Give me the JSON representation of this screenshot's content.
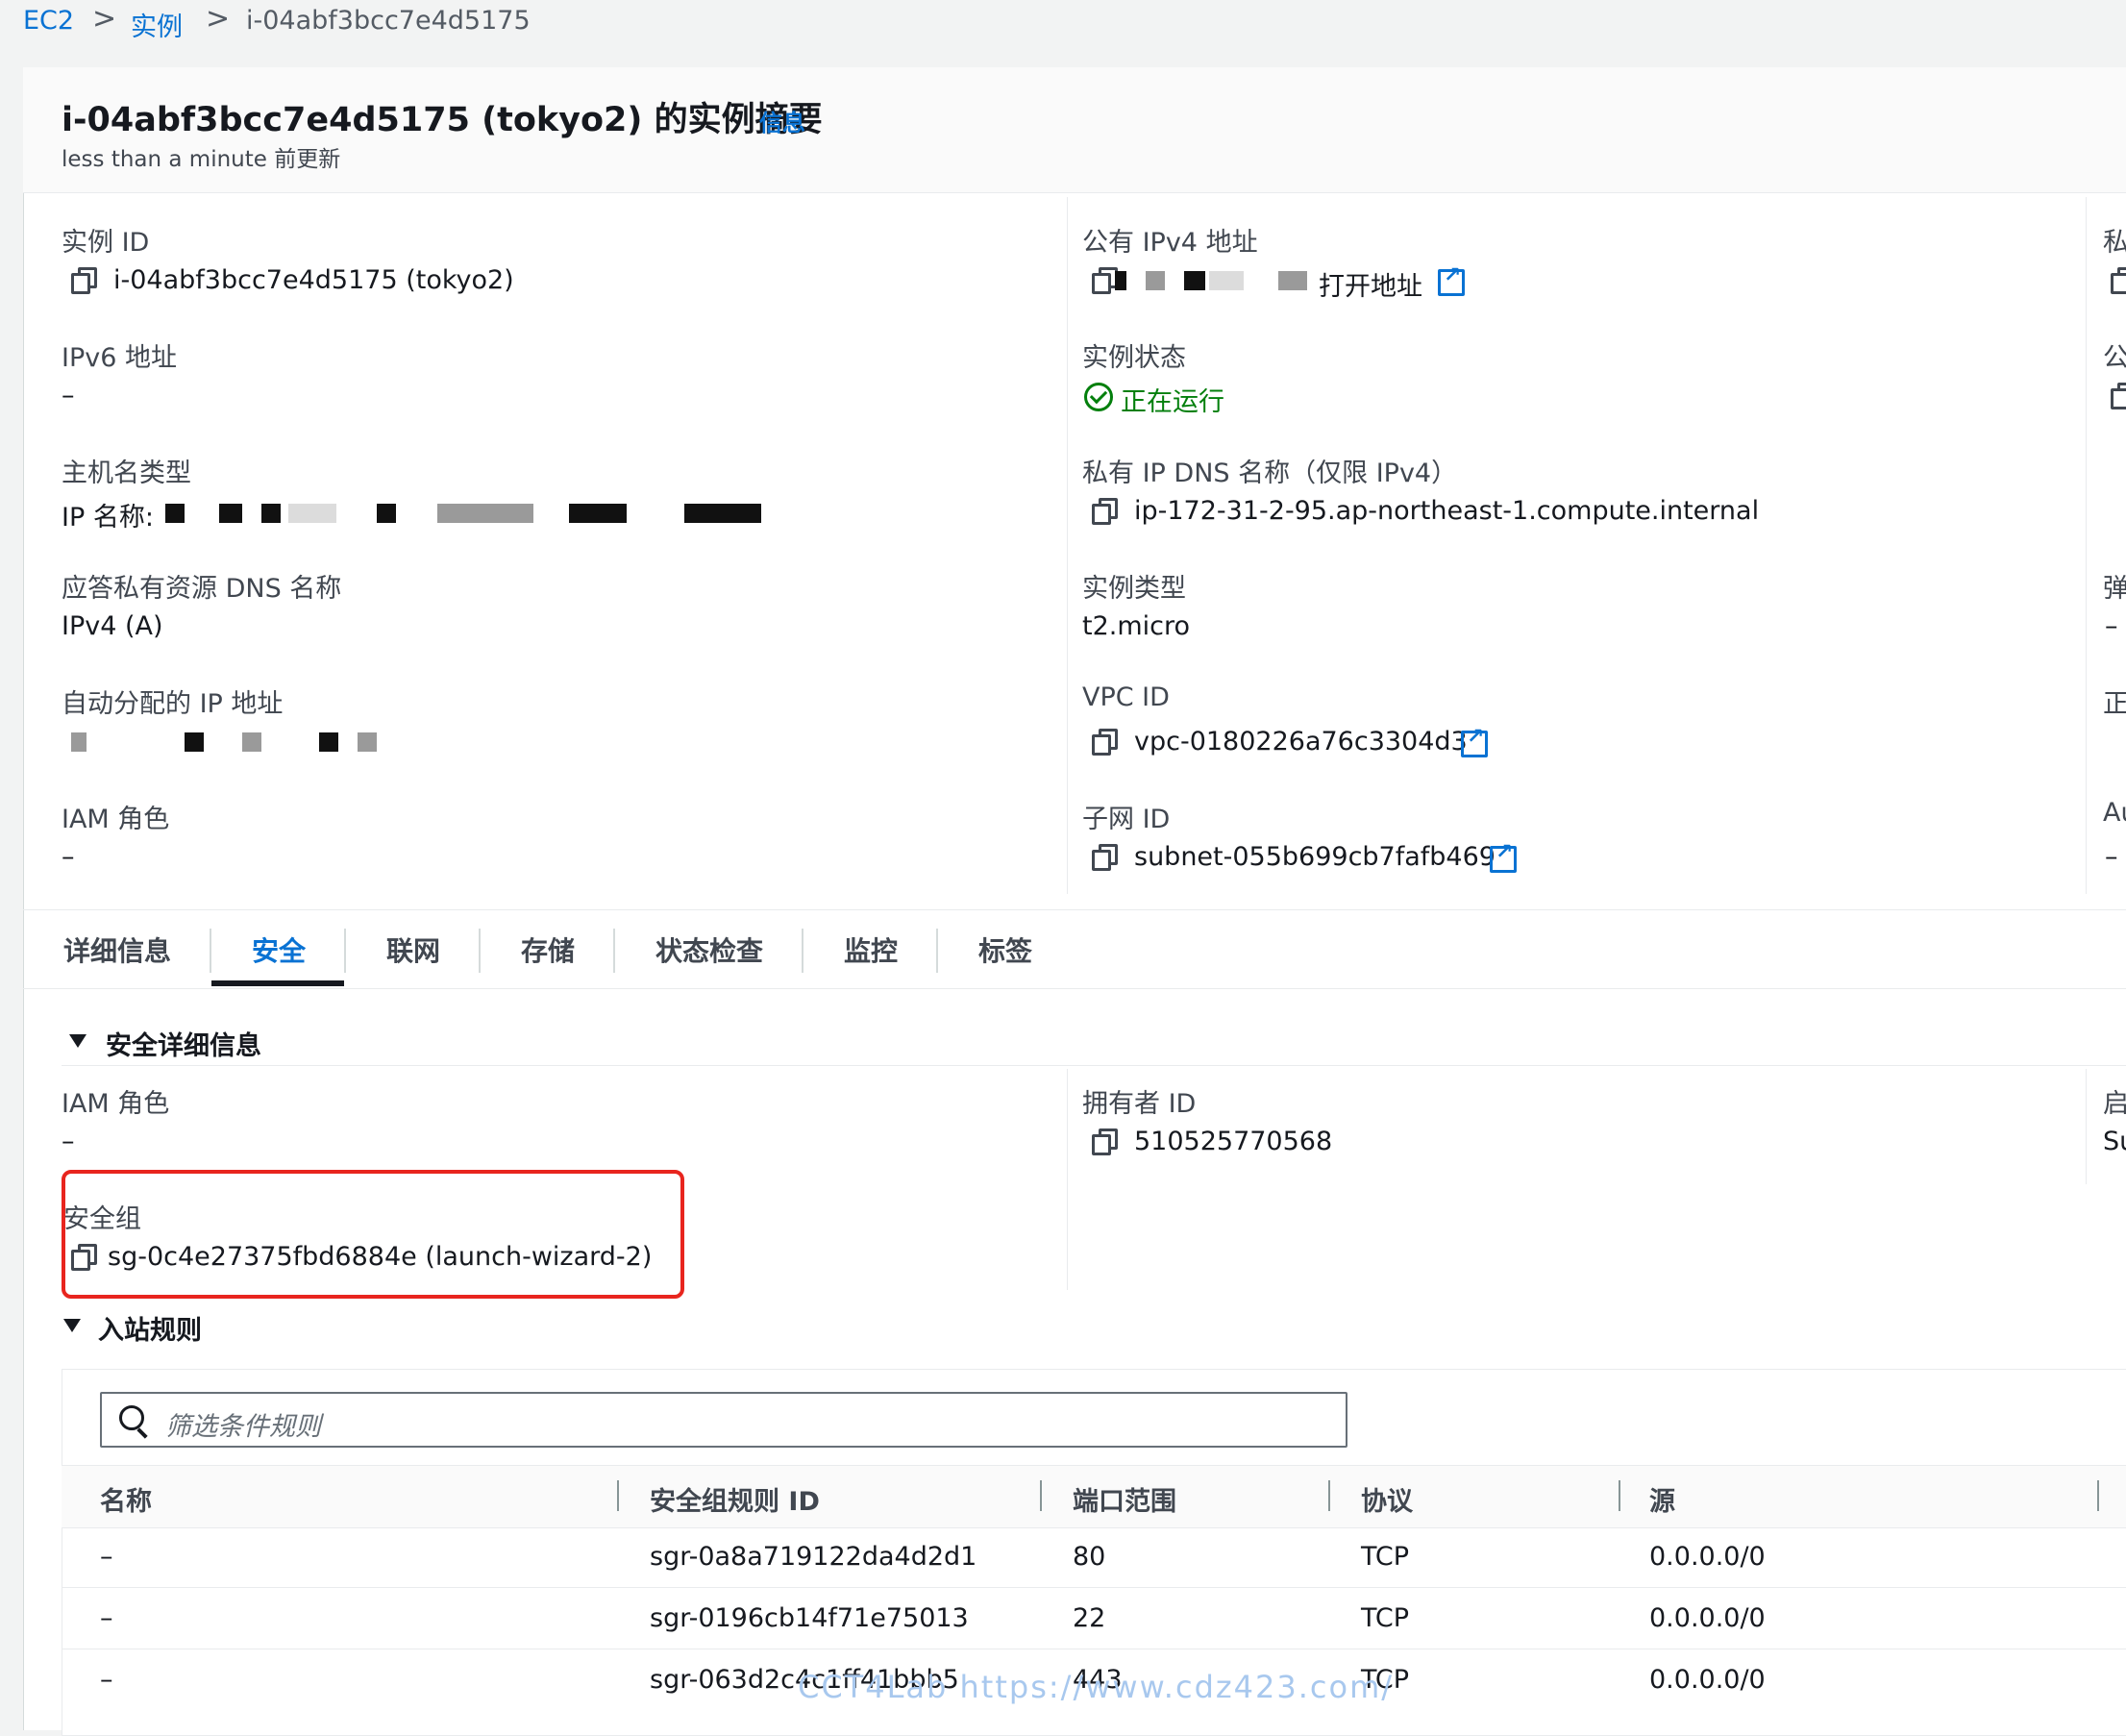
{
  "breadcrumb": {
    "root": "EC2",
    "section": "实例",
    "current": "i-04abf3bcc7e4d5175",
    "sep": ">"
  },
  "header": {
    "title": "i-04abf3bcc7e4d5175 (tokyo2) 的实例摘要",
    "info": "信息",
    "updated": "less than a minute 前更新"
  },
  "summary": {
    "instance_id_label": "实例 ID",
    "instance_id": "i-04abf3bcc7e4d5175 (tokyo2)",
    "ipv6_label": "IPv6 地址",
    "ipv6": "–",
    "hostname_type_label": "主机名类型",
    "hostname_type_prefix": "IP 名称:",
    "dns_answer_label": "应答私有资源 DNS 名称",
    "dns_answer": "IPv4 (A)",
    "auto_ip_label": "自动分配的 IP 地址",
    "iam_label": "IAM 角色",
    "iam": "–",
    "public_ipv4_label": "公有 IPv4 地址",
    "open_address": "打开地址",
    "state_label": "实例状态",
    "state": "正在运行",
    "private_dns_label": "私有 IP DNS 名称（仅限 IPv4）",
    "private_dns": "ip-172-31-2-95.ap-northeast-1.compute.internal",
    "type_label": "实例类型",
    "type": "t2.micro",
    "vpc_label": "VPC ID",
    "vpc": "vpc-0180226a76c3304d3",
    "subnet_label": "子网 ID",
    "subnet": "subnet-055b699cb7fafb469",
    "col3": [
      "私",
      "公",
      "弹",
      "–",
      "正",
      "Au",
      "–"
    ]
  },
  "tabs": [
    "详细信息",
    "安全",
    "联网",
    "存储",
    "状态检查",
    "监控",
    "标签"
  ],
  "security": {
    "section_title": "安全详细信息",
    "iam_label": "IAM 角色",
    "iam": "–",
    "owner_label": "拥有者 ID",
    "owner": "510525770568",
    "sg_label": "安全组",
    "sg": "sg-0c4e27375fbd6884e (launch-wizard-2)",
    "col3_label": "启",
    "col3_value": "Su"
  },
  "inbound": {
    "title": "入站规则",
    "search_placeholder": "筛选条件规则",
    "columns": [
      "名称",
      "安全组规则 ID",
      "端口范围",
      "协议",
      "源"
    ],
    "rows": [
      {
        "name": "–",
        "id": "sgr-0a8a719122da4d2d1",
        "port": "80",
        "protocol": "TCP",
        "source": "0.0.0.0/0"
      },
      {
        "name": "–",
        "id": "sgr-0196cb14f71e75013",
        "port": "22",
        "protocol": "TCP",
        "source": "0.0.0.0/0"
      },
      {
        "name": "–",
        "id": "sgr-063d2c4c1ff41bbb5",
        "port": "443",
        "protocol": "TCP",
        "source": "0.0.0.0/0"
      }
    ]
  },
  "watermark": "CCT4Lab https://www.cdz423.com/",
  "colors": {
    "link": "#0972d3",
    "success": "#037f0c",
    "highlight": "#e8251e"
  }
}
